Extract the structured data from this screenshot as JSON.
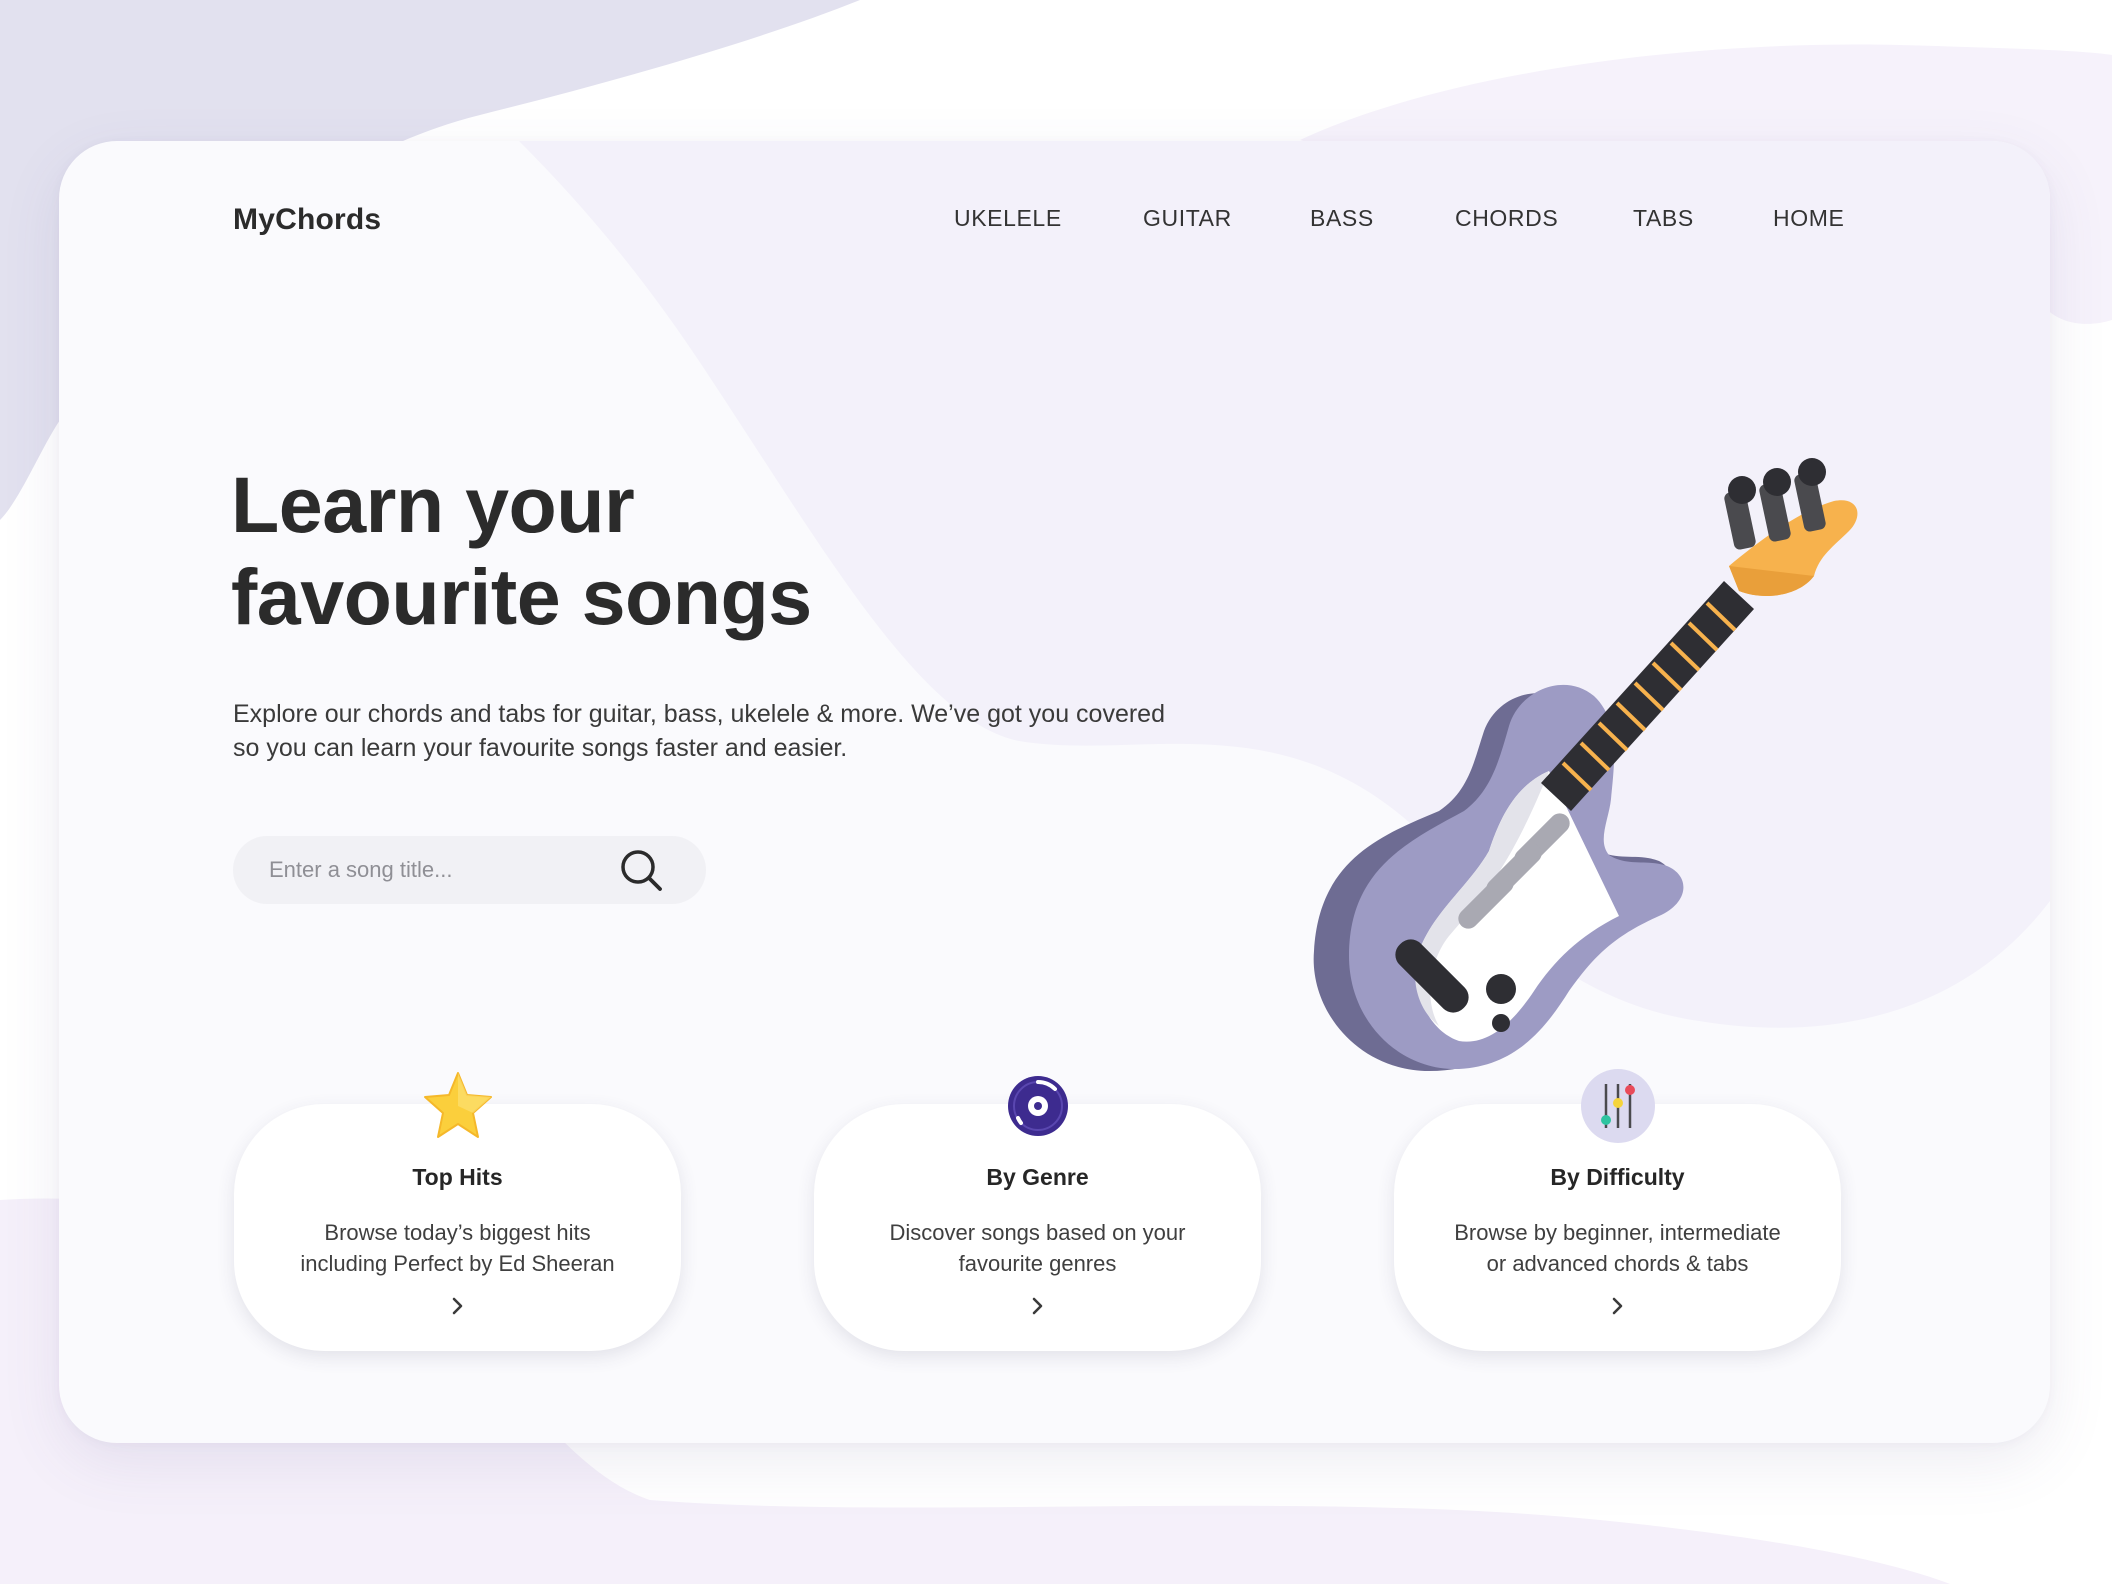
{
  "brand": {
    "name": "MyChords"
  },
  "nav": {
    "items": [
      {
        "label": "UKELELE"
      },
      {
        "label": "GUITAR"
      },
      {
        "label": "BASS"
      },
      {
        "label": "CHORDS"
      },
      {
        "label": "TABS"
      },
      {
        "label": "HOME"
      }
    ]
  },
  "hero": {
    "title_lines": [
      "Learn your",
      "favourite songs"
    ],
    "description_lines": [
      "Explore our chords and tabs for guitar, bass, ukelele & more. We’ve got you covered",
      "so you can learn your favourite songs faster and easier."
    ]
  },
  "search": {
    "placeholder": "Enter a song title...",
    "value": "",
    "icon": "search-icon"
  },
  "illustration": {
    "icon": "electric-guitar-icon"
  },
  "features": [
    {
      "icon": "star-icon",
      "title": "Top Hits",
      "description_lines": [
        "Browse today’s biggest hits",
        "including Perfect by Ed Sheeran"
      ],
      "arrow_icon": "chevron-right-icon"
    },
    {
      "icon": "vinyl-disc-icon",
      "title": "By Genre",
      "description_lines": [
        "Discover songs based on your",
        "favourite genres"
      ],
      "arrow_icon": "chevron-right-icon"
    },
    {
      "icon": "sliders-icon",
      "title": "By Difficulty",
      "description_lines": [
        "Browse by beginner, intermediate",
        "or advanced chords & tabs"
      ],
      "arrow_icon": "chevron-right-icon"
    }
  ],
  "colors": {
    "accent_lavender": "#9d9bc4",
    "background_blob": "#e6e4f3",
    "card_background": "#fafafd",
    "text_dark": "#2b2b2b",
    "star_yellow": "#fbcf3c",
    "disc_purple": "#3d2b8f",
    "guitar_head_orange": "#f7b24d"
  }
}
